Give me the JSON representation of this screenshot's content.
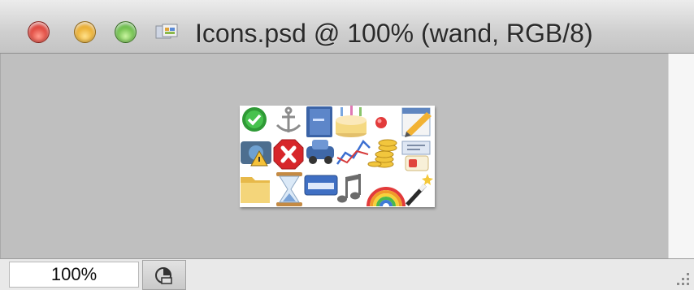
{
  "window": {
    "title": "Icons.psd @ 100% (wand, RGB/8)",
    "traffic_lights": [
      "close-icon",
      "minimize-icon",
      "zoom-icon"
    ],
    "doc_icon": "document-proxy-icon"
  },
  "canvas": {
    "background": "#bfbfbf",
    "image_name": "Icons.psd",
    "icons": [
      "check-circle-icon",
      "anchor-icon",
      "book-icon",
      "cake-icon",
      "record-dot-icon",
      "calendar-pencil-icon",
      "camera-warning-icon",
      "stop-x-icon",
      "car-icon",
      "line-graph-icon",
      "coins-icon",
      "id-card-icon",
      "folder-icon",
      "hourglass-icon",
      "html-badge-icon",
      "music-note-icon",
      "rainbow-icon",
      "magic-wand-icon"
    ]
  },
  "statusbar": {
    "zoom": "100%",
    "info_icon": "document-info-icon"
  }
}
